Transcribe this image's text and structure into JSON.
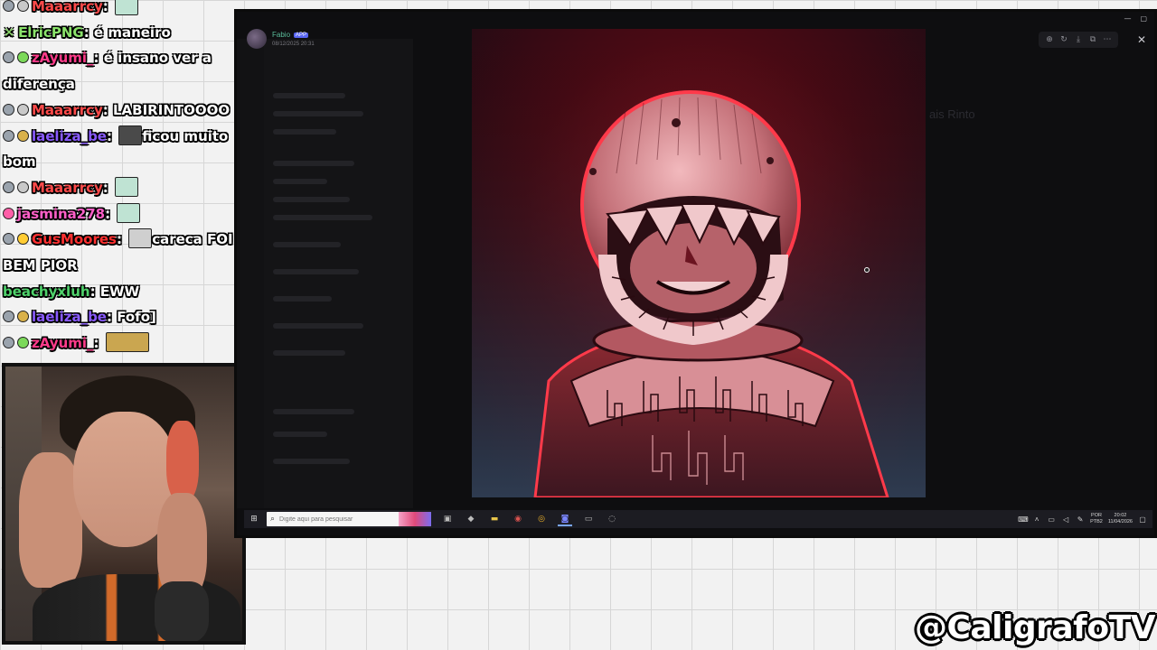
{
  "chat": {
    "messages": [
      {
        "user": "Maaarrcy",
        "user_color": "#ff4a4a",
        "text": "",
        "emote": "hands-emote",
        "badges": [
          "moon-badge",
          "cheer-badge"
        ]
      },
      {
        "user": "ElricPNG",
        "user_color": "#8be36b",
        "text": "é maneiro",
        "badges": [
          "x-badge"
        ]
      },
      {
        "user": "zAyumi_",
        "user_color": "#ff3b8a",
        "text": "é insano ver a",
        "badges": [
          "moon-badge",
          "sub-badge"
        ]
      },
      {
        "user": "",
        "user_color": "#ffffff",
        "text": "diferença",
        "badges": []
      },
      {
        "user": "Maaarrcy",
        "user_color": "#ff4a4a",
        "text": "LABIRINTOOOO",
        "badges": [
          "moon-badge",
          "cheer-badge"
        ]
      },
      {
        "user": "laeliza_be",
        "user_color": "#8a5bff",
        "text": "ficou muito",
        "emote": "face-emote",
        "badges": [
          "moon-badge",
          "gift-badge"
        ]
      },
      {
        "user": "",
        "user_color": "#ffffff",
        "text": "bom",
        "badges": []
      },
      {
        "user": "Maaarrcy",
        "user_color": "#ff4a4a",
        "text": "",
        "emote": "hands-emote",
        "badges": [
          "moon-badge",
          "cheer-badge"
        ]
      },
      {
        "user": "jasmina278",
        "user_color": "#ff5fc8",
        "text": "",
        "emote": "hands-emote",
        "badges": [
          "flower-badge"
        ]
      },
      {
        "user": "GusMoores",
        "user_color": "#ff3030",
        "text": "careca FOI",
        "emote": "letter-emote",
        "badges": [
          "moon-badge",
          "heart-badge"
        ]
      },
      {
        "user": "",
        "user_color": "#ffffff",
        "text": "BEM PIOR",
        "badges": []
      },
      {
        "user": "beachyxluh",
        "user_color": "#4fd26b",
        "text": "EWW",
        "badges": []
      },
      {
        "user": "laeliza_be",
        "user_color": "#8a5bff",
        "text": "Fofo]",
        "badges": [
          "moon-badge",
          "gift-badge"
        ]
      },
      {
        "user": "zAyumi_",
        "user_color": "#ff3b8a",
        "text": "",
        "emote": "sunglasses-emote",
        "badges": [
          "moon-badge",
          "sub-badge"
        ]
      }
    ],
    "partial_top_user": "Maaarrcy"
  },
  "viewer": {
    "username": "Fabio",
    "tag": "APP",
    "date": "08/12/2025 20:31",
    "background_title": "ais Rinto",
    "tools": [
      "zoom-icon",
      "rotate-icon",
      "download-icon",
      "open-external-icon",
      "more-icon"
    ],
    "close_glyph": "✕"
  },
  "taskbar": {
    "search_placeholder": "Digite aqui para pesquisar",
    "lang_line1": "POR",
    "lang_line2": "PTB2",
    "time": "20:02",
    "date": "11/04/2026"
  },
  "overlay": {
    "handle": "@CaligrafoTV"
  },
  "colors": {
    "artwork_red": "#b8222e",
    "artwork_bg_dark": "#2a0a10",
    "discord_bg": "#0e0e10",
    "accent_blue": "#5865f2"
  }
}
